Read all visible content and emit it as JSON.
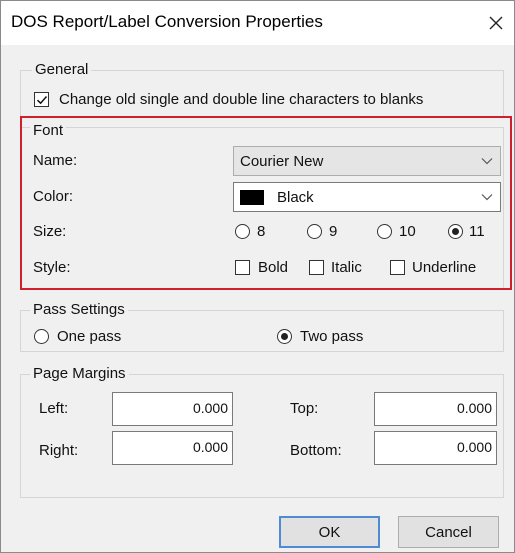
{
  "window": {
    "title": "DOS Report/Label Conversion Properties",
    "close_icon": "close-icon"
  },
  "general": {
    "legend": "General",
    "change_lines_label": "Change old single and double line characters to blanks",
    "change_lines_checked": true
  },
  "font": {
    "legend": "Font",
    "name_label": "Name:",
    "name_value": "Courier New",
    "color_label": "Color:",
    "color_value": "Black",
    "color_swatch": "#000000",
    "size_label": "Size:",
    "sizes": [
      {
        "label": "8",
        "selected": false
      },
      {
        "label": "9",
        "selected": false
      },
      {
        "label": "10",
        "selected": false
      },
      {
        "label": "11",
        "selected": true
      }
    ],
    "style_label": "Style:",
    "styles": [
      {
        "label": "Bold",
        "checked": false
      },
      {
        "label": "Italic",
        "checked": false
      },
      {
        "label": "Underline",
        "checked": false
      }
    ],
    "highlight_color": "#d0202e"
  },
  "pass": {
    "legend": "Pass Settings",
    "one_pass_label": "One pass",
    "one_pass_selected": false,
    "two_pass_label": "Two pass",
    "two_pass_selected": true
  },
  "margins": {
    "legend": "Page Margins",
    "left_label": "Left:",
    "left_value": "0.000",
    "top_label": "Top:",
    "top_value": "0.000",
    "right_label": "Right:",
    "right_value": "0.000",
    "bottom_label": "Bottom:",
    "bottom_value": "0.000"
  },
  "buttons": {
    "ok_label": "OK",
    "cancel_label": "Cancel"
  }
}
